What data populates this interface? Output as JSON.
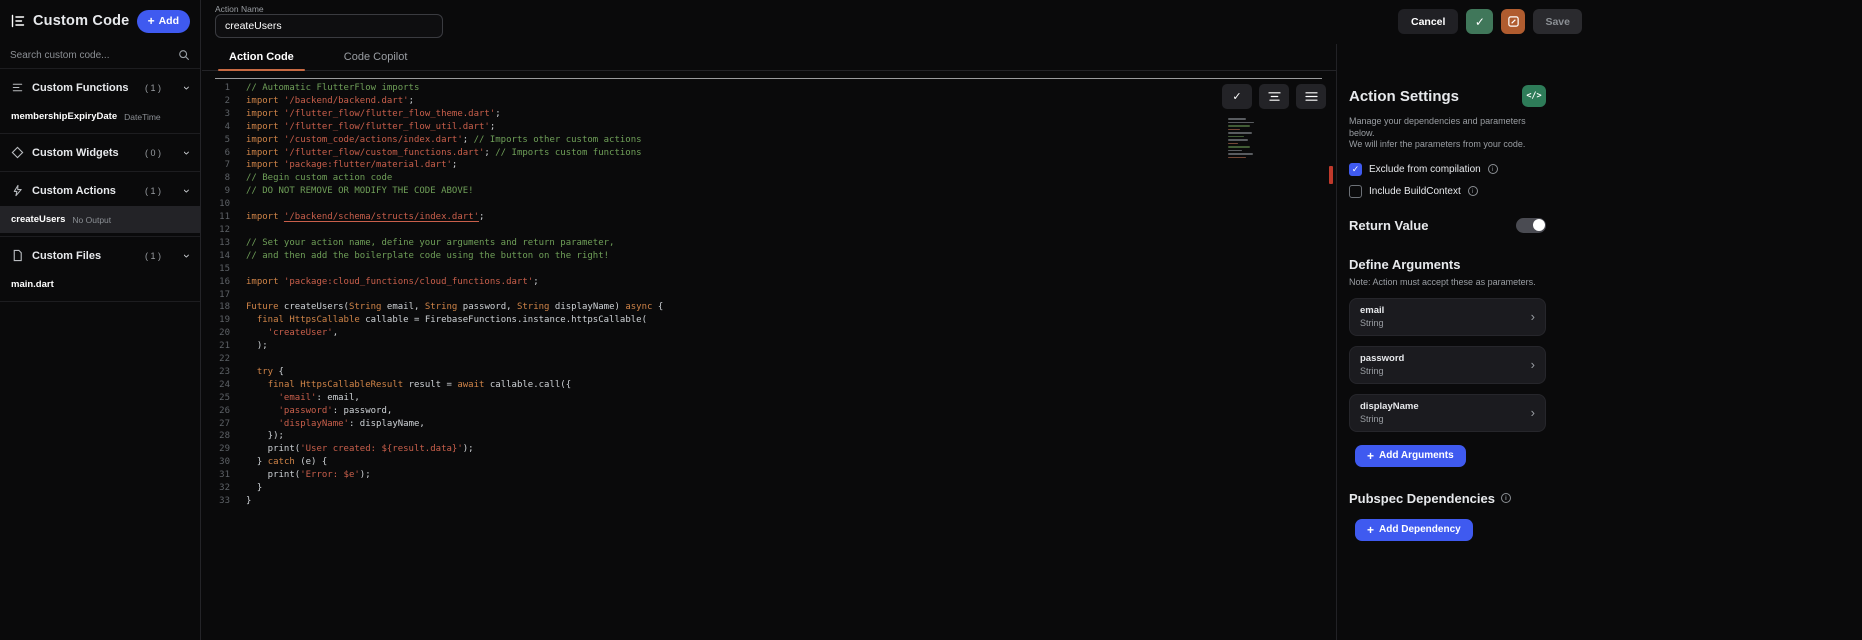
{
  "icons": {
    "plus": "+",
    "check": "✓",
    "chevron": "›",
    "info": "i",
    "code": "</>"
  },
  "colors": {
    "accent_blue": "#3f5af0",
    "validate_green": "#40775a",
    "editor_orange": "#b05c2f",
    "tab_underline": "#c76a43",
    "error_red": "#c0392b"
  },
  "sidebar": {
    "title": "Custom Code",
    "add_button_label": "Add",
    "search_placeholder": "Search custom code...",
    "sections": [
      {
        "icon": "custom-functions-icon",
        "label": "Custom Functions",
        "count": "( 1 )",
        "items": [
          {
            "name": "membershipExpiryDate",
            "meta": "DateTime",
            "selected": false
          }
        ]
      },
      {
        "icon": "custom-widgets-icon",
        "label": "Custom Widgets",
        "count": "( 0 )",
        "items": []
      },
      {
        "icon": "custom-actions-icon",
        "label": "Custom Actions",
        "count": "( 1 )",
        "items": [
          {
            "name": "createUsers",
            "meta": "No Output",
            "selected": true
          }
        ]
      },
      {
        "icon": "custom-files-icon",
        "label": "Custom Files",
        "count": "( 1 )",
        "items": [
          {
            "name": "main.dart",
            "meta": "",
            "selected": false
          }
        ]
      }
    ]
  },
  "topbar": {
    "field_label": "Action Name",
    "field_value": "createUsers",
    "cancel_label": "Cancel",
    "save_label": "Save"
  },
  "tabs": [
    {
      "label": "Action Code",
      "active": true
    },
    {
      "label": "Code Copilot",
      "active": false
    }
  ],
  "editor": {
    "lines": [
      {
        "n": 1,
        "t": [
          [
            "cm",
            "// Automatic FlutterFlow imports"
          ]
        ]
      },
      {
        "n": 2,
        "t": [
          [
            "kw",
            "import"
          ],
          [
            "pl",
            " "
          ],
          [
            "st",
            "'/backend/backend.dart'"
          ],
          [
            "pl",
            ";"
          ]
        ]
      },
      {
        "n": 3,
        "t": [
          [
            "kw",
            "import"
          ],
          [
            "pl",
            " "
          ],
          [
            "st",
            "'/flutter_flow/flutter_flow_theme.dart'"
          ],
          [
            "pl",
            ";"
          ]
        ]
      },
      {
        "n": 4,
        "t": [
          [
            "kw",
            "import"
          ],
          [
            "pl",
            " "
          ],
          [
            "st",
            "'/flutter_flow/flutter_flow_util.dart'"
          ],
          [
            "pl",
            ";"
          ]
        ]
      },
      {
        "n": 5,
        "t": [
          [
            "kw",
            "import"
          ],
          [
            "pl",
            " "
          ],
          [
            "st",
            "'/custom_code/actions/index.dart'"
          ],
          [
            "pl",
            "; "
          ],
          [
            "cm",
            "// Imports other custom actions"
          ]
        ]
      },
      {
        "n": 6,
        "t": [
          [
            "kw",
            "import"
          ],
          [
            "pl",
            " "
          ],
          [
            "st",
            "'/flutter_flow/custom_functions.dart'"
          ],
          [
            "pl",
            "; "
          ],
          [
            "cm",
            "// Imports custom functions"
          ]
        ]
      },
      {
        "n": 7,
        "t": [
          [
            "kw",
            "import"
          ],
          [
            "pl",
            " "
          ],
          [
            "st",
            "'package:flutter/material.dart'"
          ],
          [
            "pl",
            ";"
          ]
        ]
      },
      {
        "n": 8,
        "t": [
          [
            "cm",
            "// Begin custom action code"
          ]
        ]
      },
      {
        "n": 9,
        "t": [
          [
            "cm",
            "// DO NOT REMOVE OR MODIFY THE CODE ABOVE!"
          ]
        ]
      },
      {
        "n": 10,
        "t": []
      },
      {
        "n": 11,
        "t": [
          [
            "kw",
            "import"
          ],
          [
            "pl",
            " "
          ],
          [
            "stu",
            "'/backend/schema/structs/index.dart'"
          ],
          [
            "pl",
            ";"
          ]
        ]
      },
      {
        "n": 12,
        "t": []
      },
      {
        "n": 13,
        "t": [
          [
            "cm",
            "// Set your action name, define your arguments and return parameter,"
          ]
        ]
      },
      {
        "n": 14,
        "t": [
          [
            "cm",
            "// and then add the boilerplate code using the button on the right!"
          ]
        ]
      },
      {
        "n": 15,
        "t": []
      },
      {
        "n": 16,
        "t": [
          [
            "kw",
            "import"
          ],
          [
            "pl",
            " "
          ],
          [
            "st",
            "'package:cloud_functions/cloud_functions.dart'"
          ],
          [
            "pl",
            ";"
          ]
        ]
      },
      {
        "n": 17,
        "t": []
      },
      {
        "n": 18,
        "t": [
          [
            "kw",
            "Future"
          ],
          [
            "pl",
            " createUsers("
          ],
          [
            "kw",
            "String"
          ],
          [
            "pl",
            " email, "
          ],
          [
            "kw",
            "String"
          ],
          [
            "pl",
            " password, "
          ],
          [
            "kw",
            "String"
          ],
          [
            "pl",
            " displayName) "
          ],
          [
            "kw",
            "async"
          ],
          [
            "pl",
            " {"
          ]
        ]
      },
      {
        "n": 19,
        "t": [
          [
            "pl",
            "  "
          ],
          [
            "kw",
            "final"
          ],
          [
            "pl",
            " "
          ],
          [
            "kw",
            "HttpsCallable"
          ],
          [
            "pl",
            " callable = FirebaseFunctions.instance.httpsCallable("
          ]
        ]
      },
      {
        "n": 20,
        "t": [
          [
            "pl",
            "    "
          ],
          [
            "st",
            "'createUser'"
          ],
          [
            "pl",
            ","
          ]
        ]
      },
      {
        "n": 21,
        "t": [
          [
            "pl",
            "  );"
          ]
        ]
      },
      {
        "n": 22,
        "t": []
      },
      {
        "n": 23,
        "t": [
          [
            "pl",
            "  "
          ],
          [
            "kw",
            "try"
          ],
          [
            "pl",
            " {"
          ]
        ]
      },
      {
        "n": 24,
        "t": [
          [
            "pl",
            "    "
          ],
          [
            "kw",
            "final"
          ],
          [
            "pl",
            " "
          ],
          [
            "kw",
            "HttpsCallableResult"
          ],
          [
            "pl",
            " result = "
          ],
          [
            "kw",
            "await"
          ],
          [
            "pl",
            " callable.call({"
          ]
        ]
      },
      {
        "n": 25,
        "t": [
          [
            "pl",
            "      "
          ],
          [
            "st",
            "'email'"
          ],
          [
            "pl",
            ": email,"
          ]
        ]
      },
      {
        "n": 26,
        "t": [
          [
            "pl",
            "      "
          ],
          [
            "st",
            "'password'"
          ],
          [
            "pl",
            ": password,"
          ]
        ]
      },
      {
        "n": 27,
        "t": [
          [
            "pl",
            "      "
          ],
          [
            "st",
            "'displayName'"
          ],
          [
            "pl",
            ": displayName,"
          ]
        ]
      },
      {
        "n": 28,
        "t": [
          [
            "pl",
            "    });"
          ]
        ]
      },
      {
        "n": 29,
        "t": [
          [
            "pl",
            "    print("
          ],
          [
            "st",
            "'User created: ${result.data}'"
          ],
          [
            "pl",
            ");"
          ]
        ]
      },
      {
        "n": 30,
        "t": [
          [
            "pl",
            "  } "
          ],
          [
            "kw",
            "catch"
          ],
          [
            "pl",
            " (e) {"
          ]
        ]
      },
      {
        "n": 31,
        "t": [
          [
            "pl",
            "    print("
          ],
          [
            "st",
            "'Error: $e'"
          ],
          [
            "pl",
            ");"
          ]
        ]
      },
      {
        "n": 32,
        "t": [
          [
            "pl",
            "  }"
          ]
        ]
      },
      {
        "n": 33,
        "t": [
          [
            "pl",
            "}"
          ]
        ]
      }
    ]
  },
  "settings": {
    "title": "Action Settings",
    "desc1": "Manage your dependencies and parameters below.",
    "desc2": "We will infer the parameters from your code.",
    "checkboxes": [
      {
        "label": "Exclude from compilation",
        "checked": true
      },
      {
        "label": "Include BuildContext",
        "checked": false
      }
    ],
    "return_value_label": "Return Value",
    "define_arguments_label": "Define Arguments",
    "arguments_note": "Note: Action must accept these as parameters.",
    "arguments": [
      {
        "name": "email",
        "type": "String"
      },
      {
        "name": "password",
        "type": "String"
      },
      {
        "name": "displayName",
        "type": "String"
      }
    ],
    "add_arguments_label": "Add Arguments",
    "pubspec_label": "Pubspec Dependencies",
    "add_dependency_label": "Add Dependency"
  }
}
